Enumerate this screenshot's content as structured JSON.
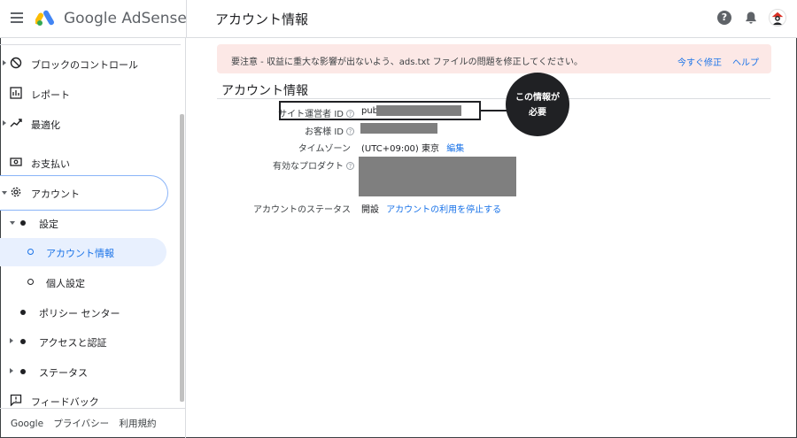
{
  "header": {
    "brand_google": "Google",
    "brand_adsense": "AdSense",
    "page_title": "アカウント情報",
    "help_glyph": "?"
  },
  "sidebar": {
    "items": [
      {
        "label": "ブロックのコントロール",
        "icon": "block-icon",
        "expand": "collapsed"
      },
      {
        "label": "レポート",
        "icon": "report-icon"
      },
      {
        "label": "最適化",
        "icon": "trend-icon",
        "expand": "collapsed"
      },
      {
        "label": "お支払い",
        "icon": "payment-icon"
      },
      {
        "label": "アカウント",
        "icon": "gear-icon",
        "expand": "expanded",
        "highlighted": true
      },
      {
        "label": "設定",
        "expand": "expanded"
      },
      {
        "label": "アカウント情報",
        "active": true
      },
      {
        "label": "個人設定"
      },
      {
        "label": "ポリシー センター"
      },
      {
        "label": "アクセスと認証",
        "expand": "collapsed"
      },
      {
        "label": "ステータス",
        "expand": "collapsed"
      },
      {
        "label": "フィードバック",
        "icon": "feedback-icon"
      }
    ],
    "footer": [
      "Google",
      "プライバシー",
      "利用規約"
    ]
  },
  "banner": {
    "text": "要注意 - 収益に重大な影響が出ないよう、ads.txt ファイルの問題を修正してください。",
    "fix_label": "今すぐ修正",
    "help_label": "ヘルプ",
    "color": "#fce8e6"
  },
  "account_info": {
    "section_title": "アカウント情報",
    "rows": {
      "publisher_id": {
        "label": "サイト運営者 ID",
        "value": "pub-"
      },
      "customer_id": {
        "label": "お客様 ID"
      },
      "timezone": {
        "label": "タイムゾーン",
        "value": "(UTC+09:00) 東京",
        "link": "編集"
      },
      "products": {
        "label": "有効なプロダクト"
      },
      "status": {
        "label": "アカウントのステータス",
        "value": "開設",
        "link": "アカウントの利用を停止する"
      }
    },
    "help_glyph": "?"
  },
  "annotation": {
    "line1": "この情報が",
    "line2": "必要"
  },
  "colors": {
    "accent": "#1a73e8",
    "redaction": "#7f7f7f"
  }
}
